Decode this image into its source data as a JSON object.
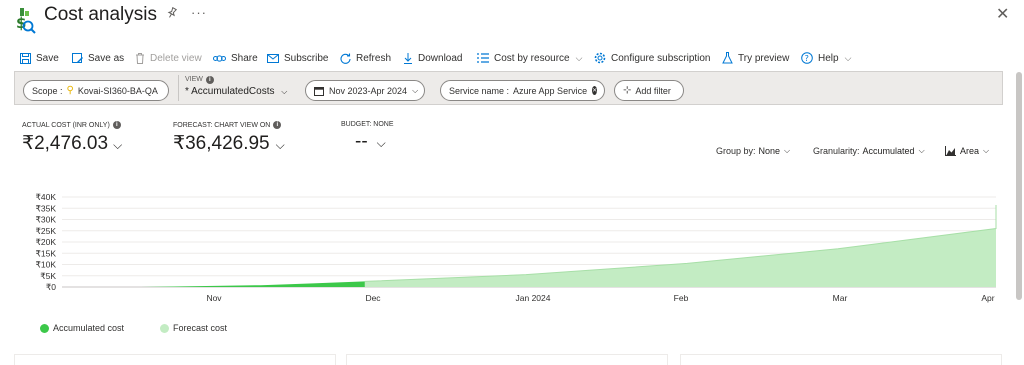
{
  "header": {
    "title": "Cost analysis",
    "pin_icon": "pin-icon",
    "more_icon": "more-icon",
    "close_icon": "close-icon"
  },
  "toolbar": {
    "save": "Save",
    "save_as": "Save as",
    "delete_view": "Delete view",
    "share": "Share",
    "subscribe": "Subscribe",
    "refresh": "Refresh",
    "download": "Download",
    "cost_by_resource": "Cost by resource",
    "configure_subscription": "Configure subscription",
    "try_preview": "Try preview",
    "help": "Help"
  },
  "filters": {
    "scope_label": "Scope :",
    "scope_value": "Kovai-SI360-BA-QA",
    "view_label": "VIEW",
    "view_value": "* AccumulatedCosts",
    "date_range": "Nov 2023-Apr 2024",
    "service_label": "Service name :",
    "service_value": "Azure App Service",
    "add_filter": "Add filter"
  },
  "kpis": {
    "actual_label": "ACTUAL COST (INR ONLY)",
    "actual_value": "₹2,476.03",
    "forecast_label": "FORECAST: CHART VIEW ON",
    "forecast_value": "₹36,426.95",
    "budget_label": "BUDGET: NONE",
    "budget_value": "--"
  },
  "controls": {
    "group_by_label": "Group by:",
    "group_by_value": "None",
    "granularity_label": "Granularity:",
    "granularity_value": "Accumulated",
    "chart_type_value": "Area"
  },
  "colors": {
    "accent": "#0078d4",
    "accumulated": "#3cc84a",
    "forecast": "#c3ecc3",
    "forecast_line": "#a7dfa7"
  },
  "chart_data": {
    "type": "area",
    "x_ticks": [
      "Nov",
      "Dec",
      "Jan 2024",
      "Feb",
      "Mar",
      "Apr"
    ],
    "y_ticks": [
      "₹0",
      "₹5K",
      "₹10K",
      "₹15K",
      "₹20K",
      "₹25K",
      "₹30K",
      "₹35K",
      "₹40K"
    ],
    "ylim": [
      0,
      40000
    ],
    "series": [
      {
        "name": "Accumulated cost",
        "x": [
          "Oct 18",
          "Nov 10",
          "Nov 20",
          "Nov 30"
        ],
        "values": [
          0,
          800,
          1600,
          2476
        ]
      },
      {
        "name": "Forecast cost",
        "x": [
          "Nov 30",
          "Dec 31",
          "Jan 31",
          "Feb 29",
          "Mar 31",
          "Apr 30"
        ],
        "values": [
          2476,
          5500,
          10500,
          17000,
          26000,
          36427
        ]
      }
    ]
  }
}
